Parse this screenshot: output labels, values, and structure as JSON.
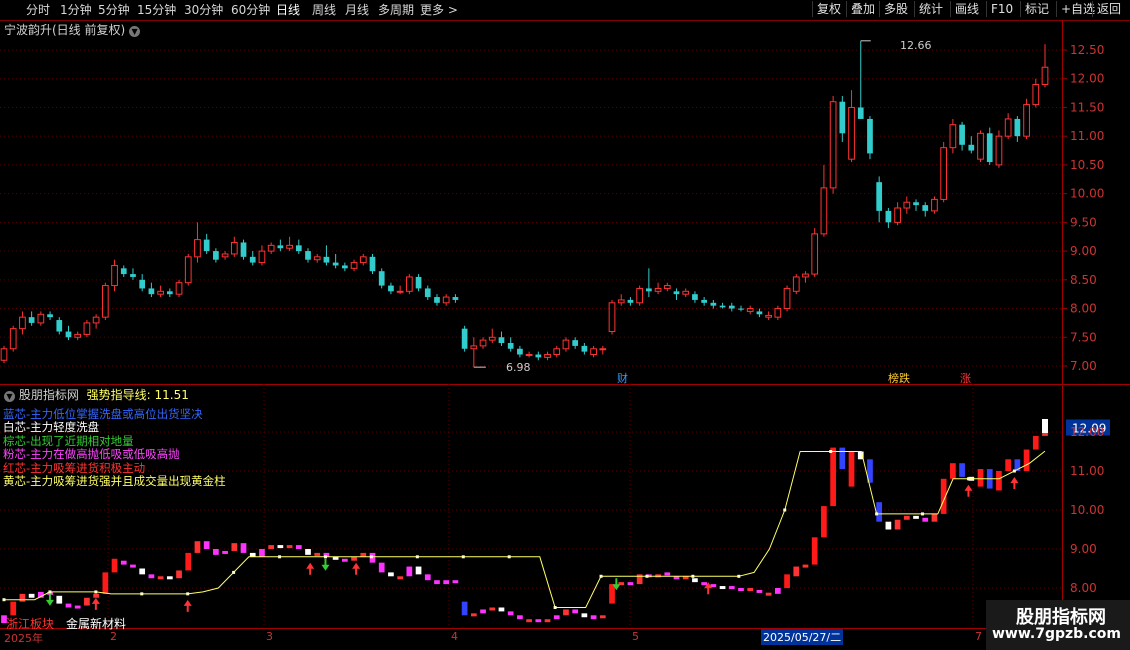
{
  "toolbar": {
    "left_items": [
      "分时",
      "1分钟",
      "5分钟",
      "15分钟",
      "30分钟",
      "60分钟",
      "日线",
      "周线",
      "月线",
      "多周期",
      "更多 >"
    ],
    "active_item": "日线",
    "right_items": [
      "复权",
      "叠加",
      "多股",
      "统计",
      "画线",
      "F10",
      "标记",
      "+自选",
      "返回"
    ]
  },
  "chart_title": "宁波韵升(日线 前复权)",
  "indicator_header": {
    "name": "股朋指标网",
    "label": "强势指导线: 11.51"
  },
  "legend": [
    {
      "text": "蓝芯-主力低位掌握洗盘或高位出货坚决",
      "color": "#3366ff"
    },
    {
      "text": "白芯-主力轻度洗盘",
      "color": "#ffffff"
    },
    {
      "text": "棕芯-出现了近期相对地量",
      "color": "#33cc33"
    },
    {
      "text": "粉芯-主力在做高抛低吸或低吸高抛",
      "color": "#ff44ff"
    },
    {
      "text": "红芯-主力吸筹进货积极主动",
      "color": "#ff3333"
    },
    {
      "text": "黄芯-主力吸筹进货强并且成交量出现黄金柱",
      "color": "#ffff66"
    }
  ],
  "price_tags": {
    "high": "12.66",
    "low": "6.98"
  },
  "event_tags": [
    {
      "text": "财",
      "color": "#3399ff"
    },
    {
      "text": "榜跌",
      "color": "#ffcc33"
    },
    {
      "text": "涨",
      "color": "#ff3333"
    }
  ],
  "upper_axis": [
    "12.50",
    "12.00",
    "11.50",
    "11.00",
    "10.50",
    "10.00",
    "9.50",
    "9.00",
    "8.50",
    "8.00",
    "7.50",
    "7.00"
  ],
  "lower_axis": [
    "12.09",
    "12.00",
    "11.00",
    "10.00",
    "9.00",
    "8.00"
  ],
  "dates": [
    "2025年",
    "2",
    "3",
    "4",
    "5",
    "7"
  ],
  "highlight_date": "2025/05/27/二",
  "sectors": [
    {
      "text": "浙江板块",
      "color": "#ff3333"
    },
    {
      "text": "金属新材料",
      "color": "#ffffff"
    }
  ],
  "watermark": {
    "name": "股朋指标网",
    "url": "www.7gpzb.com"
  },
  "colors": {
    "up": "#ff3333",
    "down": "#33cccc",
    "grid": "#5a0000",
    "yellow": "#ffff66"
  },
  "chart_data": {
    "type": "candlestick",
    "ylim": [
      6.75,
      12.75
    ],
    "ohlc": [
      [
        7.1,
        7.35,
        7.05,
        7.3
      ],
      [
        7.3,
        7.7,
        7.25,
        7.65
      ],
      [
        7.65,
        7.95,
        7.55,
        7.85
      ],
      [
        7.85,
        7.95,
        7.7,
        7.75
      ],
      [
        7.75,
        7.95,
        7.7,
        7.9
      ],
      [
        7.9,
        7.95,
        7.8,
        7.85
      ],
      [
        7.8,
        7.85,
        7.55,
        7.6
      ],
      [
        7.6,
        7.7,
        7.45,
        7.5
      ],
      [
        7.5,
        7.6,
        7.45,
        7.55
      ],
      [
        7.55,
        7.8,
        7.5,
        7.75
      ],
      [
        7.75,
        7.9,
        7.65,
        7.85
      ],
      [
        7.85,
        8.45,
        7.8,
        8.4
      ],
      [
        8.4,
        8.85,
        8.3,
        8.75
      ],
      [
        8.7,
        8.75,
        8.55,
        8.6
      ],
      [
        8.6,
        8.7,
        8.5,
        8.55
      ],
      [
        8.5,
        8.6,
        8.3,
        8.35
      ],
      [
        8.35,
        8.45,
        8.2,
        8.25
      ],
      [
        8.25,
        8.4,
        8.2,
        8.3
      ],
      [
        8.3,
        8.35,
        8.2,
        8.25
      ],
      [
        8.25,
        8.5,
        8.2,
        8.45
      ],
      [
        8.45,
        8.95,
        8.4,
        8.9
      ],
      [
        8.9,
        9.5,
        8.8,
        9.2
      ],
      [
        9.2,
        9.3,
        8.95,
        9.0
      ],
      [
        9.0,
        9.05,
        8.8,
        8.85
      ],
      [
        8.9,
        9.0,
        8.85,
        8.95
      ],
      [
        8.95,
        9.25,
        8.9,
        9.15
      ],
      [
        9.15,
        9.2,
        8.85,
        8.9
      ],
      [
        8.9,
        9.0,
        8.75,
        8.8
      ],
      [
        8.8,
        9.1,
        8.75,
        9.0
      ],
      [
        9.0,
        9.15,
        8.95,
        9.1
      ],
      [
        9.1,
        9.2,
        9.0,
        9.05
      ],
      [
        9.05,
        9.25,
        9.0,
        9.1
      ],
      [
        9.1,
        9.2,
        8.95,
        9.0
      ],
      [
        9.0,
        9.05,
        8.8,
        8.85
      ],
      [
        8.85,
        8.95,
        8.8,
        8.9
      ],
      [
        8.9,
        9.1,
        8.75,
        8.8
      ],
      [
        8.8,
        8.95,
        8.7,
        8.75
      ],
      [
        8.75,
        8.8,
        8.65,
        8.7
      ],
      [
        8.7,
        8.85,
        8.65,
        8.8
      ],
      [
        8.8,
        8.95,
        8.75,
        8.9
      ],
      [
        8.9,
        8.95,
        8.6,
        8.65
      ],
      [
        8.65,
        8.7,
        8.35,
        8.4
      ],
      [
        8.4,
        8.45,
        8.25,
        8.3
      ],
      [
        8.3,
        8.4,
        8.25,
        8.3
      ],
      [
        8.3,
        8.6,
        8.25,
        8.55
      ],
      [
        8.55,
        8.6,
        8.3,
        8.35
      ],
      [
        8.35,
        8.4,
        8.15,
        8.2
      ],
      [
        8.2,
        8.25,
        8.05,
        8.1
      ],
      [
        8.1,
        8.25,
        8.05,
        8.2
      ],
      [
        8.2,
        8.25,
        8.1,
        8.15
      ],
      [
        7.65,
        7.7,
        7.25,
        7.3
      ],
      [
        7.3,
        7.5,
        6.98,
        7.35
      ],
      [
        7.35,
        7.5,
        7.3,
        7.45
      ],
      [
        7.45,
        7.65,
        7.4,
        7.5
      ],
      [
        7.5,
        7.6,
        7.35,
        7.4
      ],
      [
        7.4,
        7.5,
        7.25,
        7.3
      ],
      [
        7.3,
        7.35,
        7.15,
        7.2
      ],
      [
        7.2,
        7.25,
        7.15,
        7.2
      ],
      [
        7.2,
        7.25,
        7.1,
        7.15
      ],
      [
        7.15,
        7.25,
        7.1,
        7.2
      ],
      [
        7.2,
        7.35,
        7.15,
        7.3
      ],
      [
        7.3,
        7.5,
        7.25,
        7.45
      ],
      [
        7.45,
        7.5,
        7.3,
        7.35
      ],
      [
        7.35,
        7.4,
        7.2,
        7.25
      ],
      [
        7.2,
        7.35,
        7.15,
        7.3
      ],
      [
        7.3,
        7.35,
        7.2,
        7.3
      ],
      [
        7.6,
        8.15,
        7.55,
        8.1
      ],
      [
        8.1,
        8.25,
        8.05,
        8.15
      ],
      [
        8.15,
        8.2,
        8.05,
        8.1
      ],
      [
        8.1,
        8.4,
        8.05,
        8.35
      ],
      [
        8.35,
        8.7,
        8.2,
        8.3
      ],
      [
        8.3,
        8.45,
        8.25,
        8.35
      ],
      [
        8.35,
        8.45,
        8.3,
        8.4
      ],
      [
        8.3,
        8.35,
        8.15,
        8.25
      ],
      [
        8.25,
        8.35,
        8.2,
        8.3
      ],
      [
        8.25,
        8.3,
        8.1,
        8.15
      ],
      [
        8.15,
        8.2,
        8.05,
        8.1
      ],
      [
        8.1,
        8.15,
        8.0,
        8.05
      ],
      [
        8.05,
        8.1,
        8.0,
        8.02
      ],
      [
        8.05,
        8.1,
        7.95,
        8.0
      ],
      [
        8.0,
        8.05,
        7.95,
        7.98
      ],
      [
        7.95,
        8.05,
        7.9,
        8.0
      ],
      [
        7.95,
        8.0,
        7.85,
        7.9
      ],
      [
        7.85,
        7.95,
        7.8,
        7.88
      ],
      [
        7.85,
        8.05,
        7.8,
        8.0
      ],
      [
        8.0,
        8.4,
        7.95,
        8.35
      ],
      [
        8.3,
        8.6,
        8.25,
        8.55
      ],
      [
        8.55,
        8.65,
        8.45,
        8.6
      ],
      [
        8.6,
        9.4,
        8.55,
        9.3
      ],
      [
        9.3,
        10.5,
        9.25,
        10.1
      ],
      [
        10.1,
        11.7,
        10.0,
        11.6
      ],
      [
        11.6,
        11.7,
        10.9,
        11.05
      ],
      [
        10.6,
        11.8,
        10.55,
        11.5
      ],
      [
        11.5,
        12.66,
        11.3,
        11.3
      ],
      [
        11.3,
        11.35,
        10.6,
        10.7
      ],
      [
        10.2,
        10.3,
        9.5,
        9.7
      ],
      [
        9.7,
        9.75,
        9.4,
        9.5
      ],
      [
        9.5,
        9.85,
        9.45,
        9.75
      ],
      [
        9.75,
        9.95,
        9.65,
        9.85
      ],
      [
        9.85,
        9.9,
        9.7,
        9.8
      ],
      [
        9.8,
        9.85,
        9.6,
        9.7
      ],
      [
        9.7,
        9.95,
        9.65,
        9.9
      ],
      [
        9.9,
        10.9,
        9.85,
        10.8
      ],
      [
        10.8,
        11.3,
        10.7,
        11.2
      ],
      [
        11.2,
        11.25,
        10.75,
        10.85
      ],
      [
        10.85,
        11.0,
        10.7,
        10.75
      ],
      [
        10.6,
        11.1,
        10.55,
        11.05
      ],
      [
        11.05,
        11.15,
        10.5,
        10.55
      ],
      [
        10.5,
        11.1,
        10.45,
        11.0
      ],
      [
        11.0,
        11.4,
        10.95,
        11.3
      ],
      [
        11.3,
        11.35,
        10.9,
        11.0
      ],
      [
        11.0,
        11.65,
        10.95,
        11.55
      ],
      [
        11.55,
        12.0,
        11.5,
        11.9
      ],
      [
        11.9,
        12.6,
        11.85,
        12.2
      ]
    ],
    "indicator_line": [
      7.7,
      7.7,
      7.7,
      7.9,
      7.9,
      7.9,
      7.9,
      7.85,
      7.85,
      7.85,
      7.85,
      7.85,
      7.85,
      7.9,
      8.0,
      8.4,
      8.8,
      8.8,
      8.8,
      8.8,
      8.8,
      8.8,
      8.8,
      8.8,
      8.8,
      8.8,
      8.8,
      8.8,
      8.8,
      8.8,
      8.8,
      8.8,
      8.8,
      8.8,
      8.8,
      8.8,
      7.5,
      7.5,
      7.5,
      8.3,
      8.3,
      8.3,
      8.3,
      8.3,
      8.3,
      8.3,
      8.3,
      8.3,
      8.3,
      8.4,
      9.0,
      10.0,
      11.5,
      11.5,
      11.5,
      11.5,
      11.5,
      9.9,
      9.9,
      9.9,
      9.9,
      9.9,
      10.8,
      10.8,
      10.8,
      10.8,
      11.0,
      11.2,
      11.51
    ],
    "markers": [
      {
        "type": "green-down",
        "i": 3
      },
      {
        "type": "red-up",
        "i": 6
      },
      {
        "type": "red-up",
        "i": 12
      },
      {
        "type": "red-up",
        "i": 20
      },
      {
        "type": "green-down",
        "i": 21
      },
      {
        "type": "red-up",
        "i": 23
      },
      {
        "type": "green-down",
        "i": 40
      },
      {
        "type": "red-up",
        "i": 46
      },
      {
        "type": "red-up",
        "i": 63
      },
      {
        "type": "red-up",
        "i": 66
      }
    ]
  }
}
